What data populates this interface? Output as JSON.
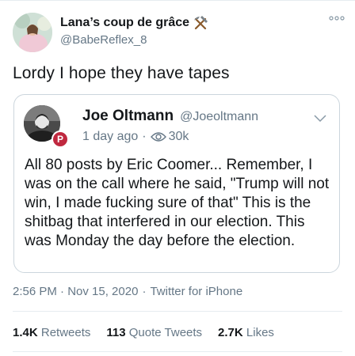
{
  "tweet": {
    "display_name": "Lana’s coup de grâce",
    "handle": "@BabeReflex_8",
    "text": "Lordy I hope they have tapes",
    "timestamp": "2:56 PM · Nov 15, 2020",
    "source": "Twitter for iPhone",
    "stats": [
      {
        "value": "1.4K",
        "label": "Retweets"
      },
      {
        "value": "113",
        "label": "Quote Tweets"
      },
      {
        "value": "2.7K",
        "label": "Likes"
      }
    ]
  },
  "quote": {
    "name": "Joe Oltmann",
    "handle": "@Joeoltmann",
    "time": "1 day ago",
    "views": "30k",
    "badge": "P",
    "body": "All 80 posts by Eric Coomer... Remember, I was on the call where he said, \"Trump will not win, I made fucking sure of that\" This is the shitbag that interfered in our election. This was Monday the day before the election."
  },
  "icons": {
    "hammer": "hammer-pick-icon",
    "more": "more-icon",
    "chevron": "chevron-down-icon",
    "views": "eye-icon"
  },
  "colors": {
    "text": "#14171a",
    "secondary": "#657786",
    "border": "#ccd6dd",
    "badge": "#c0283f"
  }
}
